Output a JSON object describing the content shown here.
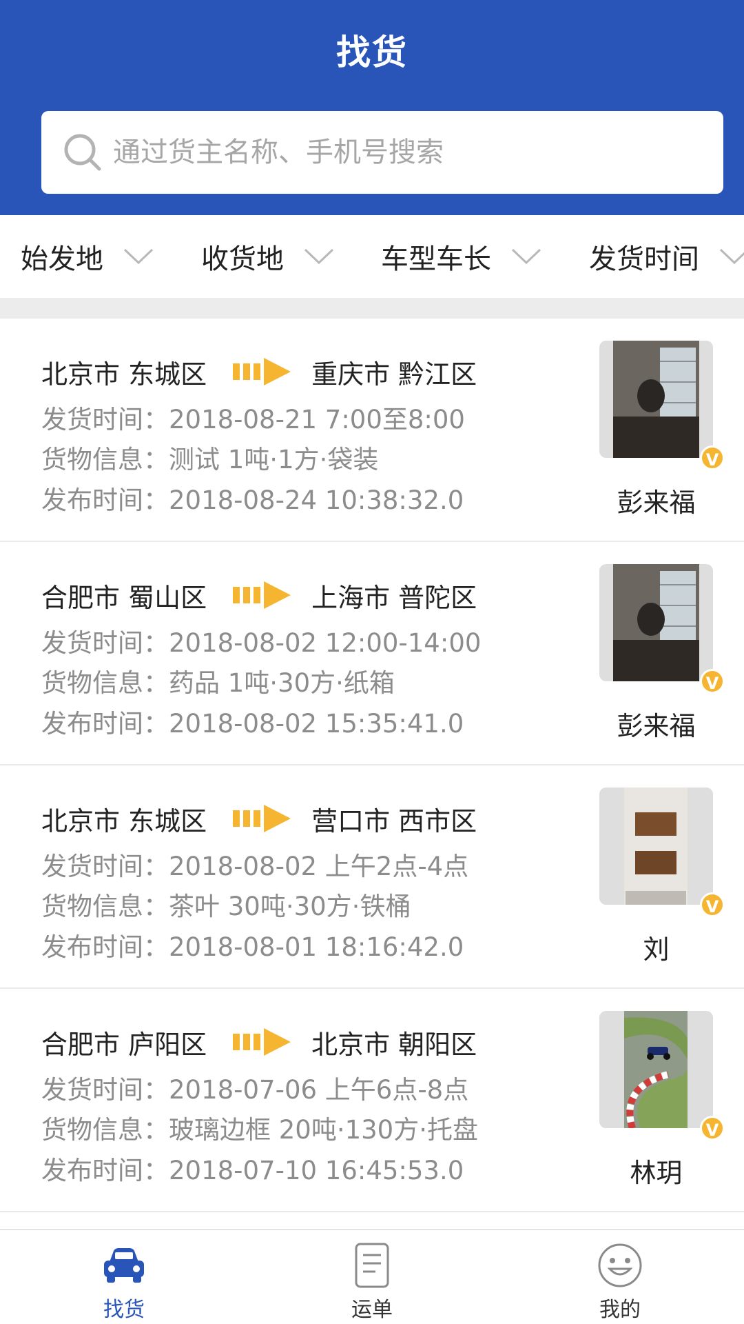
{
  "header": {
    "title": "找货",
    "search_placeholder": "通过货主名称、手机号搜索"
  },
  "filters": [
    "始发地",
    "收货地",
    "车型车长",
    "发货时间"
  ],
  "listings": [
    {
      "from": "北京市 东城区",
      "to": "重庆市 黔江区",
      "ship_time": "发货时间：2018-08-21 7:00至8:00",
      "cargo": "货物信息：测试 1吨·1方·袋装",
      "publish_time": "发布时间：2018-08-24 10:38:32.0",
      "owner": "彭来福",
      "badge": "V"
    },
    {
      "from": "合肥市 蜀山区",
      "to": "上海市 普陀区",
      "ship_time": "发货时间：2018-08-02 12:00-14:00",
      "cargo": "货物信息：药品 1吨·30方·纸箱",
      "publish_time": "发布时间：2018-08-02 15:35:41.0",
      "owner": "彭来福",
      "badge": "V"
    },
    {
      "from": "北京市 东城区",
      "to": "营口市 西市区",
      "ship_time": "发货时间：2018-08-02 上午2点-4点",
      "cargo": "货物信息：茶叶 30吨·30方·铁桶",
      "publish_time": "发布时间：2018-08-01 18:16:42.0",
      "owner": "刘",
      "badge": "V"
    },
    {
      "from": "合肥市 庐阳区",
      "to": "北京市 朝阳区",
      "ship_time": "发货时间：2018-07-06 上午6点-8点",
      "cargo": "货物信息：玻璃边框 20吨·130方·托盘",
      "publish_time": "发布时间：2018-07-10 16:45:53.0",
      "owner": "林玥",
      "badge": "V"
    }
  ],
  "bottom_nav": [
    {
      "label": "找货",
      "icon": "car-icon",
      "active": true
    },
    {
      "label": "运单",
      "icon": "document-icon",
      "active": false
    },
    {
      "label": "我的",
      "icon": "smiley-icon",
      "active": false
    }
  ],
  "colors": {
    "primary": "#2955b8",
    "accent": "#f5b530",
    "secondary_text": "#8c8c8c"
  }
}
